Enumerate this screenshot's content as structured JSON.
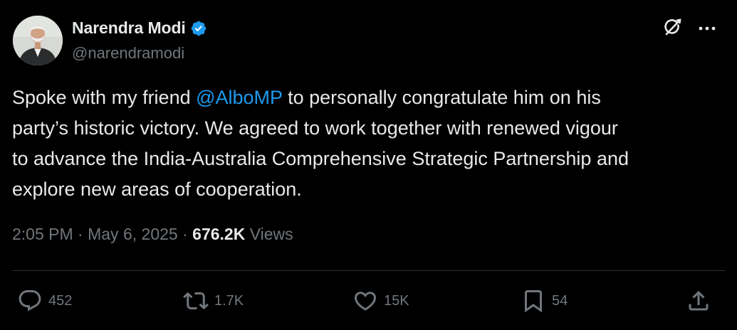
{
  "author": {
    "display_name": "Narendra Modi",
    "handle": "@narendramodi",
    "verified": true,
    "verified_color": "#1d9bf0"
  },
  "header_actions": {
    "grok_icon": "grok-icon",
    "more_icon": "more-icon"
  },
  "tweet": {
    "line1_pre": "Spoke with my friend ",
    "mention": "@AlboMP",
    "line1_post": " to personally congratulate him on his",
    "line2": "party’s historic victory. We agreed to work together with renewed vigour",
    "line3": "to advance the India-Australia Comprehensive Strategic Partnership and",
    "line4": "explore new areas of cooperation."
  },
  "meta": {
    "time": "2:05 PM",
    "separator1": " · ",
    "date": "May 6, 2025",
    "separator2": " · ",
    "views_count": "676.2K",
    "views_label": " Views"
  },
  "actions": {
    "replies": "452",
    "reposts": "1.7K",
    "likes": "15K",
    "bookmarks": "54"
  },
  "colors": {
    "background": "#000000",
    "text": "#e7e9ea",
    "muted": "#71767b",
    "link": "#1d9bf0",
    "divider": "#2f3336"
  }
}
